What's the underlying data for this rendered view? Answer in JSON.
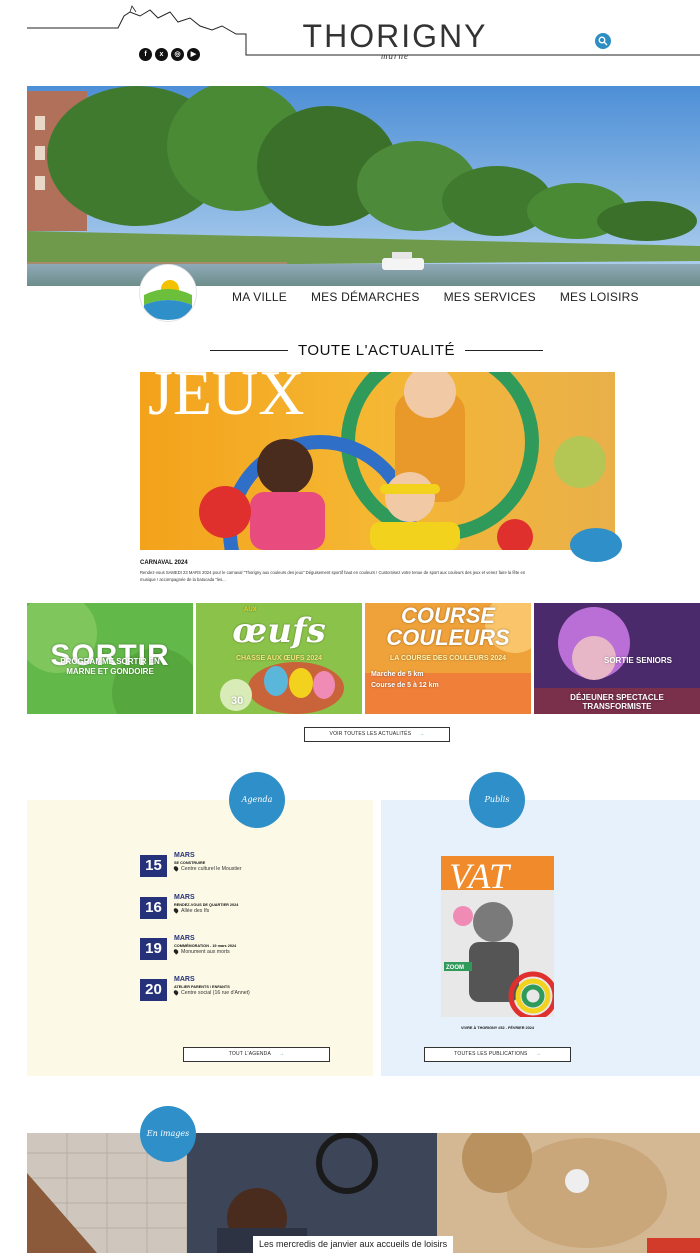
{
  "header": {
    "brand": "THORIGNY",
    "brand_sub": "marne",
    "social": [
      "f",
      "x",
      "ig",
      "yt"
    ]
  },
  "nav": {
    "items": [
      "MA VILLE",
      "MES DÉMARCHES",
      "MES SERVICES",
      "MES LOISIRS"
    ]
  },
  "news": {
    "section_title": "TOUTE L'ACTUALITÉ",
    "feature": {
      "image_text": "JEUX",
      "title": "CARNAVAL 2024",
      "description": "Rendez-vous SAMEDI 23 MARS 2024 pour le carnaval \"Thorigny aux couleurs des jeux\" Déguisement sportif haut en couleurs ! Customisez votre tenue de sport aux couleurs des jeux et venez faire la fête en musique ! accompagnée de la batucada \"les..."
    },
    "tiles": [
      {
        "label": "PROGRAMME SORTIR EN MARNE ET GONDOIRE",
        "word": "SORTIR"
      },
      {
        "label": "CHASSE AUX ŒUFS 2024",
        "word": "œufs",
        "sub": "AUX",
        "num": "30"
      },
      {
        "label": "LA COURSE DES COULEURS 2024",
        "word": "COURSE COULEURS",
        "detail1": "Marche de 5 km",
        "detail2": "Course de 5 à 12 km"
      },
      {
        "label": "SORTIE SENIORS",
        "sub": "DÉJEUNER SPECTACLE TRANSFORMISTE"
      }
    ],
    "see_all": "VOIR TOUTES LES ACTUALITÉS"
  },
  "agenda": {
    "bubble": "Agenda",
    "events": [
      {
        "day": "15",
        "month": "MARS",
        "title": "SE CONSTRUIRE",
        "place": "Centre culturel le Moustier"
      },
      {
        "day": "16",
        "month": "MARS",
        "title": "RENDEZ-VOUS DE QUARTIER 2024",
        "place": "Allée des Ifs"
      },
      {
        "day": "19",
        "month": "MARS",
        "title": "COMMÉMORATION - 19 mars 2024",
        "place": "Monument aux morts"
      },
      {
        "day": "20",
        "month": "MARS",
        "title": "ATELIER PARENTS / ENFANTS",
        "place": "Centre social (16 rue d'Annet)"
      }
    ],
    "button": "TOUT L'AGENDA"
  },
  "publications": {
    "bubble": "Publis",
    "cover_title": "VAT",
    "cover_badge": "ZOOM",
    "caption": "VIVRE À THORIGNY #52 - FÉVRIER 2024",
    "button": "TOUTES LES PUBLICATIONS"
  },
  "gallery": {
    "bubble": "En images",
    "caption": "Les mercredis de janvier aux accueils de loisirs"
  },
  "colors": {
    "accent_blue": "#2f8fc8",
    "navy": "#25327a",
    "agenda_bg": "#fcf9e6",
    "pubs_bg": "#e6f1fb"
  }
}
